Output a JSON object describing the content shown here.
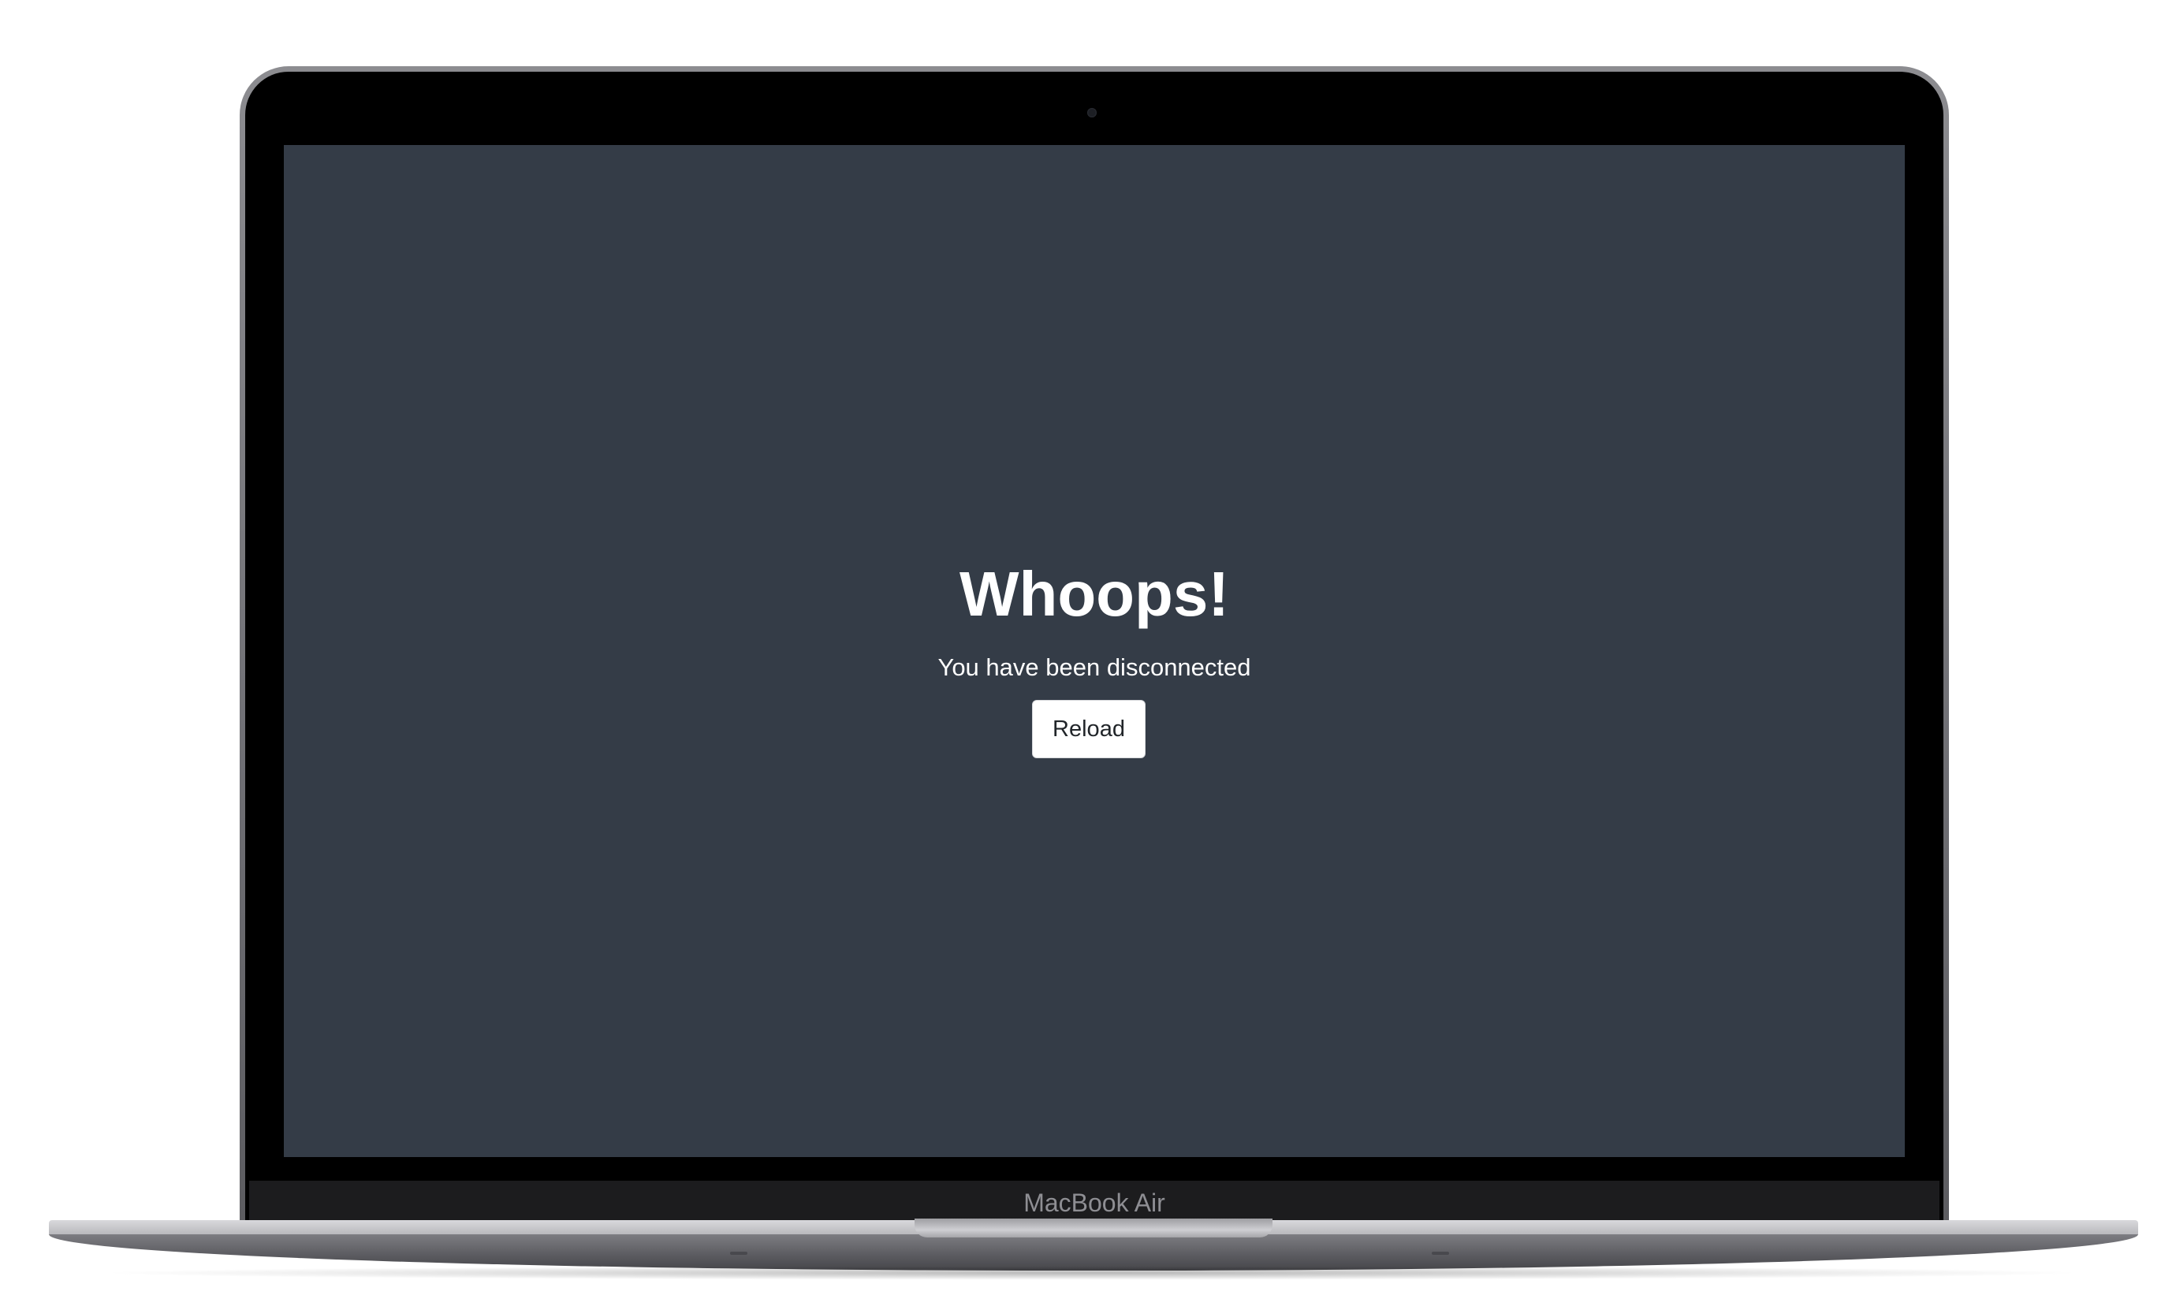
{
  "device": {
    "brand_label": "MacBook Air"
  },
  "page": {
    "heading": "Whoops!",
    "message": "You have been disconnected",
    "reload_button_label": "Reload"
  },
  "colors": {
    "screen_background": "#343c47",
    "text": "#ffffff",
    "button_background": "#ffffff",
    "button_text": "#212529"
  }
}
